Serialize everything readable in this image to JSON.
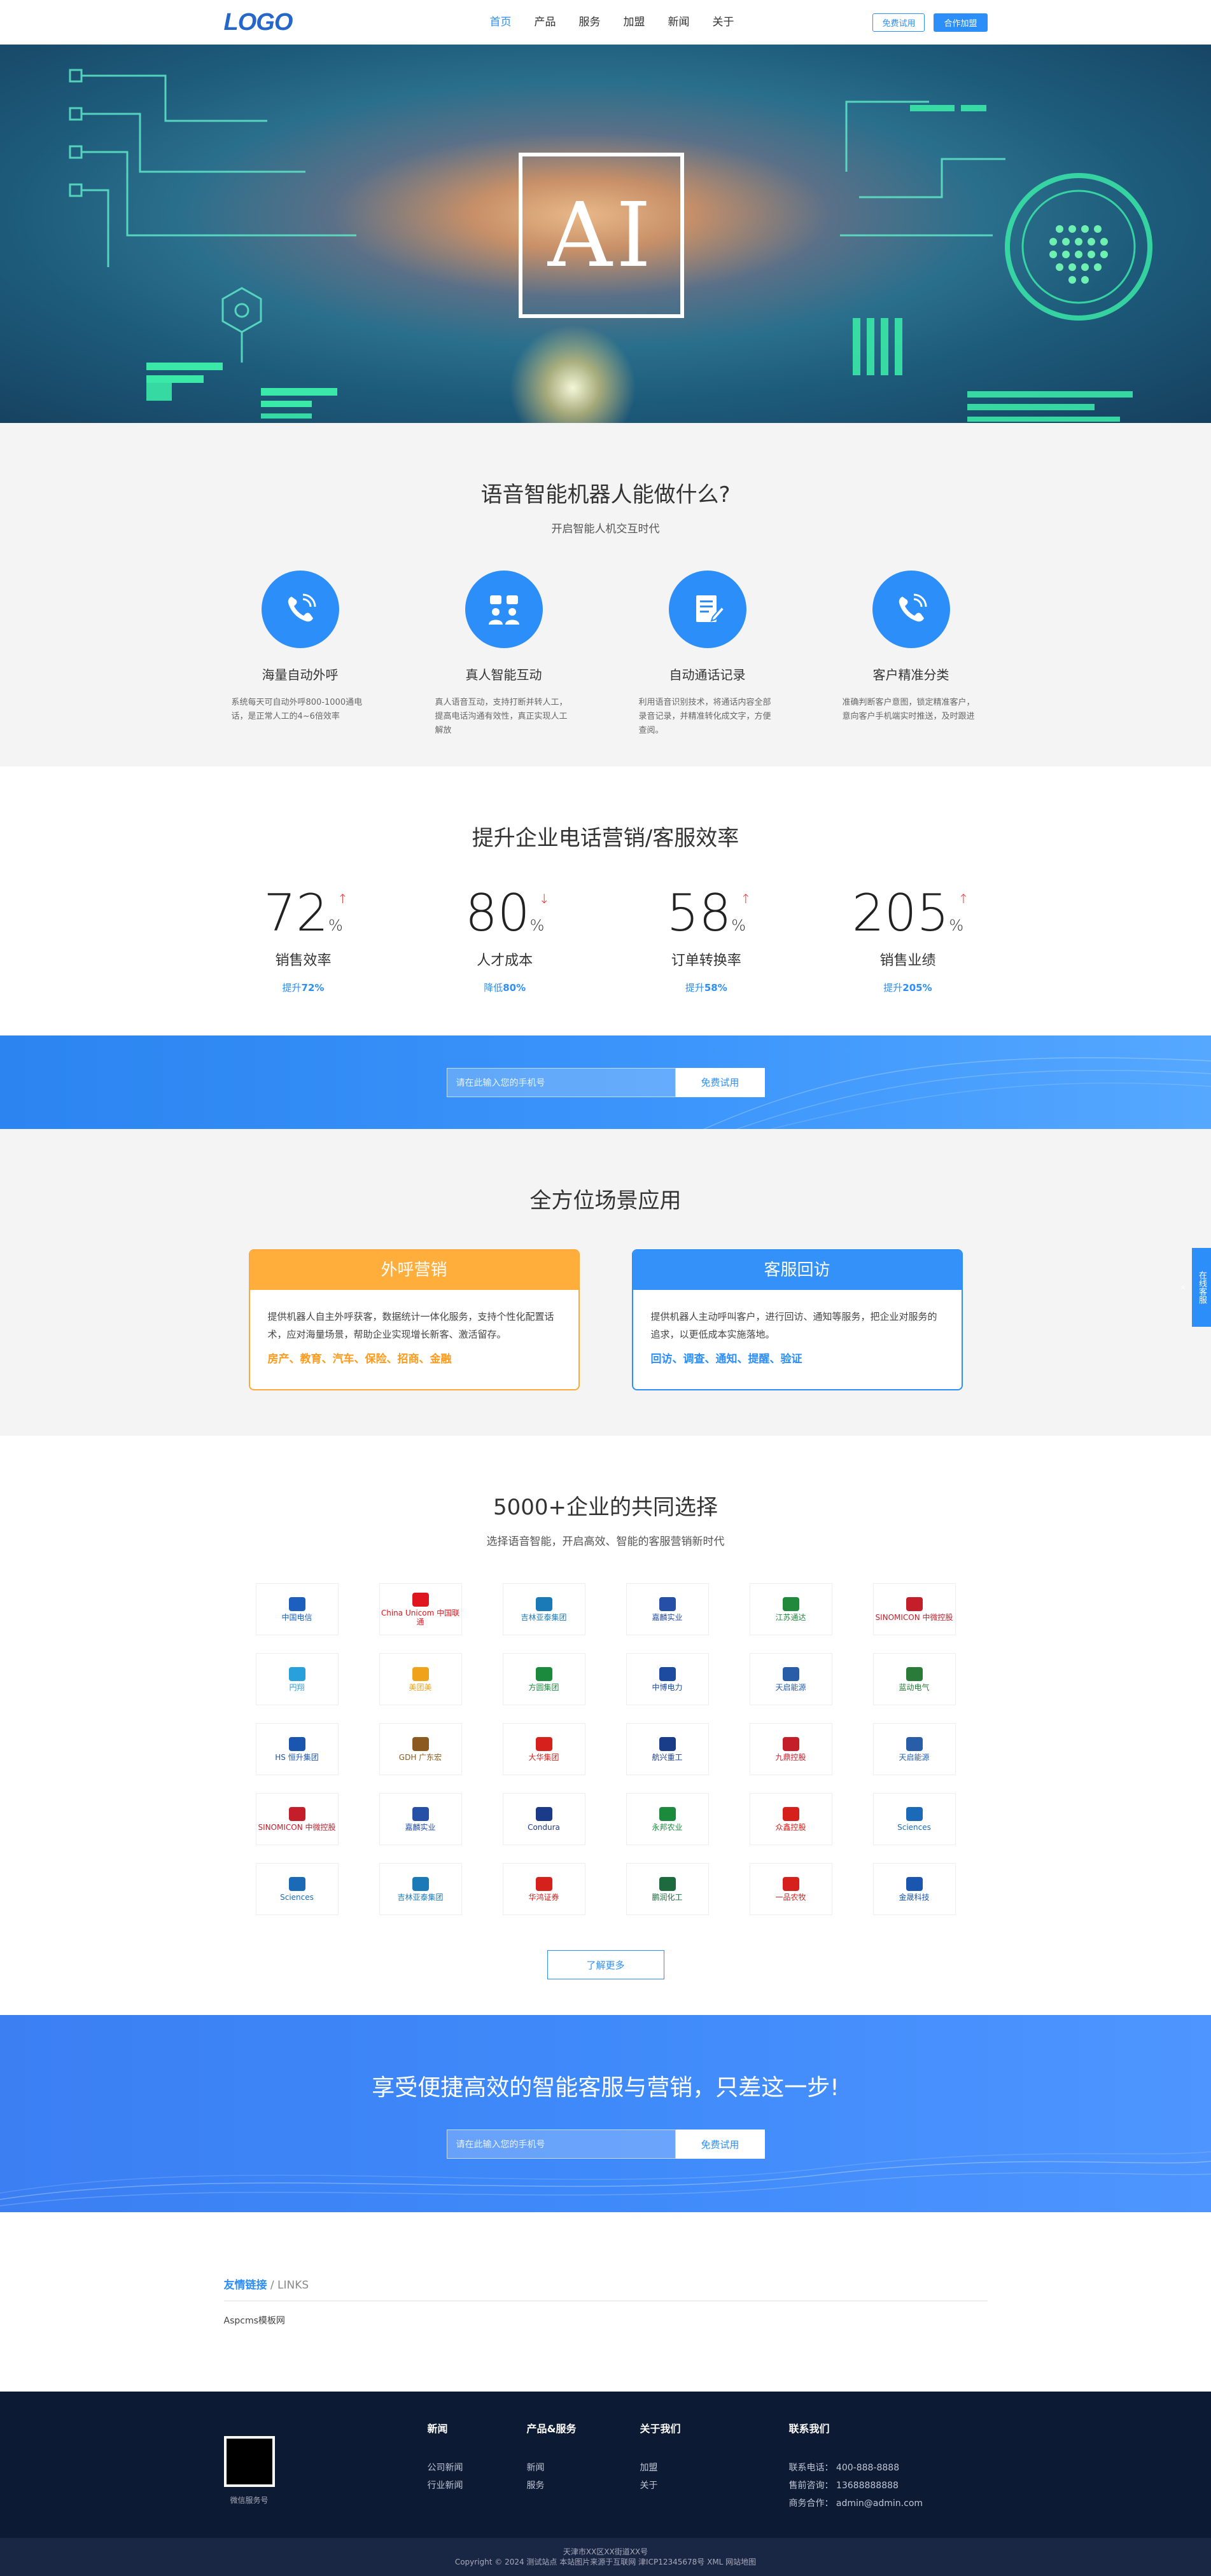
{
  "header": {
    "logo": "LOGO",
    "nav": [
      "首页",
      "产品",
      "服务",
      "加盟",
      "新闻",
      "关于"
    ],
    "btn_trial": "免费试用",
    "btn_join": "合作加盟"
  },
  "banner": {
    "ai_text": "AI"
  },
  "features": {
    "title": "语音智能机器人能做什么?",
    "subtitle": "开启智能人机交互时代",
    "items": [
      {
        "icon": "phone-call-icon",
        "title": "海量自动外呼",
        "desc": "系统每天可自动外呼800-1000通电话，是正常人工的4~6倍效率"
      },
      {
        "icon": "chat-users-icon",
        "title": "真人智能互动",
        "desc": "真人语音互动，支持打断并转人工，提高电话沟通有效性，真正实现人工解放"
      },
      {
        "icon": "record-icon",
        "title": "自动通话记录",
        "desc": "利用语音识别技术，将通话内容全部录音记录，并精准转化成文字，方便查阅。"
      },
      {
        "icon": "classify-icon",
        "title": "客户精准分类",
        "desc": "准确判断客户意图，锁定精准客户，意向客户手机端实时推送，及时跟进"
      }
    ]
  },
  "stats": {
    "title": "提升企业电话营销/客服效率",
    "items": [
      {
        "num": "72",
        "unit": "%",
        "label": "销售效率",
        "rate_pre": "提升",
        "rate": "72%"
      },
      {
        "num": "80",
        "unit": "%",
        "label": "人才成本",
        "rate_pre": "降低",
        "rate": "80%"
      },
      {
        "num": "58",
        "unit": "%",
        "label": "订单转换率",
        "rate_pre": "提升",
        "rate": "58%"
      },
      {
        "num": "205",
        "unit": "%",
        "label": "销售业绩",
        "rate_pre": "提升",
        "rate": "205%"
      }
    ]
  },
  "cta1": {
    "placeholder": "请在此输入您的手机号",
    "button": "免费试用"
  },
  "scenes": {
    "title": "全方位场景应用",
    "items": [
      {
        "title": "外呼营销",
        "desc": "提供机器人自主外呼获客，数据统计一体化服务，支持个性化配置话术，应对海量场景，帮助企业实现增长新客、激活留存。",
        "tags": "房产、教育、汽车、保险、招商、金融"
      },
      {
        "title": "客服回访",
        "desc": "提供机器人主动呼叫客户，进行回访、通知等服务，把企业对服务的追求，以更低成本实施落地。",
        "tags": "回访、调查、通知、提醒、验证"
      }
    ]
  },
  "partners": {
    "title": "5000+企业的共同选择",
    "subtitle": "选择语音智能，开启高效、智能的客服营销新时代",
    "logos": [
      {
        "name": "中国电信",
        "color": "#1d5fbf"
      },
      {
        "name": "China Unicom 中国联通",
        "color": "#e0161e"
      },
      {
        "name": "吉林亚泰集团",
        "color": "#1a7ab8"
      },
      {
        "name": "嘉麟实业",
        "color": "#2650a8"
      },
      {
        "name": "江苏通达",
        "color": "#1f8a3c"
      },
      {
        "name": "SINOMICON 中微控股",
        "color": "#c41e2a"
      },
      {
        "name": "円翔",
        "color": "#27a0dc"
      },
      {
        "name": "美团美",
        "color": "#f0a21a"
      },
      {
        "name": "方圆集团",
        "color": "#1c8a3d"
      },
      {
        "name": "中博电力",
        "color": "#1c4ba0"
      },
      {
        "name": "天启能源",
        "color": "#2a5da8"
      },
      {
        "name": "蓝动电气",
        "color": "#2a7a3a"
      },
      {
        "name": "HS 恒升集团",
        "color": "#1a55b0"
      },
      {
        "name": "GDH 广东宏",
        "color": "#8a5a20"
      },
      {
        "name": "大华集团",
        "color": "#d6201c"
      },
      {
        "name": "航兴重工",
        "color": "#1a3d8a"
      },
      {
        "name": "九鼎控股",
        "color": "#c41e2a"
      },
      {
        "name": "天启能源",
        "color": "#2a5da8"
      },
      {
        "name": "SINOMICON 中微控股",
        "color": "#c41e2a"
      },
      {
        "name": "嘉麟实业",
        "color": "#2650a8"
      },
      {
        "name": "Condura",
        "color": "#1c3a8a"
      },
      {
        "name": "永邦农业",
        "color": "#1c8a3d"
      },
      {
        "name": "众鑫控股",
        "color": "#d6201c"
      },
      {
        "name": "Sciences",
        "color": "#1a6ab8"
      },
      {
        "name": "Sciences",
        "color": "#1a6ab8"
      },
      {
        "name": "吉林亚泰集团",
        "color": "#1a7ab8"
      },
      {
        "name": "华鸿证券",
        "color": "#d6201c"
      },
      {
        "name": "鹏润化工",
        "color": "#1c6a3d"
      },
      {
        "name": "一品农牧",
        "color": "#d6201c"
      },
      {
        "name": "金晟科技",
        "color": "#1a55b0"
      }
    ],
    "more": "了解更多"
  },
  "cta2": {
    "title": "享受便捷高效的智能客服与营销，只差这一步!",
    "placeholder": "请在此输入您的手机号",
    "button": "免费试用"
  },
  "links": {
    "title": "友情链接",
    "title_en": "/ LINKS",
    "items": [
      "Aspcms模板网"
    ]
  },
  "footer": {
    "qr_caption": "微信服务号",
    "cols": [
      {
        "title": "新闻",
        "links": [
          "公司新闻",
          "行业新闻"
        ]
      },
      {
        "title": "产品&服务",
        "links": [
          "新闻",
          "服务"
        ]
      },
      {
        "title": "关于我们",
        "links": [
          "加盟",
          "关于"
        ]
      }
    ],
    "contact_title": "联系我们",
    "contacts": [
      "联系电话： 400-888-8888",
      "售前咨询： 13688888888",
      "商务合作： admin@admin.com"
    ],
    "address": "天津市XX区XX街道XX号",
    "copyright": "Copyright © 2024 测试站点 本站图片来源于互联网 津ICP12345678号  XML  网站地图"
  },
  "float": {
    "label": "在线客服"
  }
}
